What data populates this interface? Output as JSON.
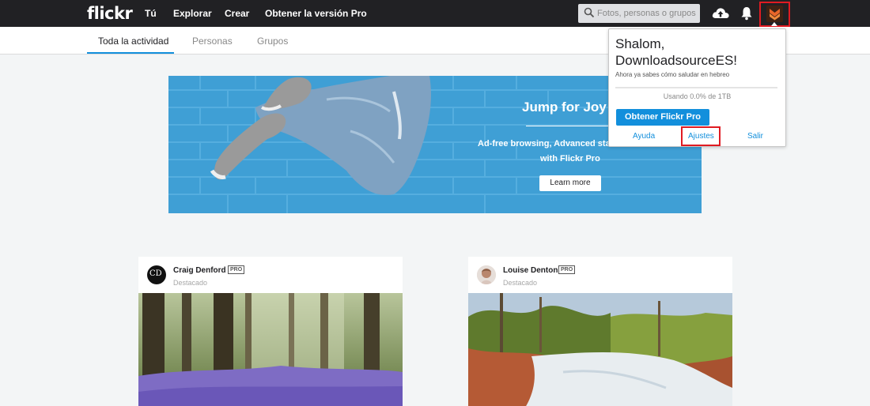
{
  "brand": {
    "logo_text": "flickr"
  },
  "nav": {
    "links": [
      "Tú",
      "Explorar",
      "Crear",
      "Obtener la versión Pro"
    ]
  },
  "search": {
    "placeholder": "Fotos, personas o grupos"
  },
  "icons": {
    "search": "magnifier-icon",
    "upload": "cloud-upload-icon",
    "notifications": "bell-icon",
    "avatar": "user-avatar-icon"
  },
  "subnav": {
    "tabs": [
      "Toda la actividad",
      "Personas",
      "Grupos"
    ],
    "active_tab": "Toda la actividad"
  },
  "banner": {
    "title": "Jump for Joy",
    "line1": "Ad-free browsing, Advanced sta",
    "line2": "with Flickr Pro",
    "button": "Learn more"
  },
  "feed": [
    {
      "user": "Craig Denford",
      "avatar_text": "CD",
      "badge": "PRO",
      "label": "Destacado"
    },
    {
      "user": "Louise Denton",
      "avatar_text": "",
      "badge": "PRO",
      "label": "Destacado"
    }
  ],
  "account_menu": {
    "greeting_line1": "Shalom,",
    "greeting_line2": "DownloadsourceES!",
    "hint": "Ahora ya sabes cómo saludar en hebreo",
    "usage_text": "Usando 0.0% de 1TB",
    "usage_fraction": 0.0,
    "pro_button": "Obtener Flickr Pro",
    "links": [
      "Ayuda",
      "Ajustes",
      "Salir"
    ]
  },
  "colors": {
    "topbar": "#212124",
    "accent_blue": "#128fdc",
    "highlight_red": "#e01b22",
    "banner_blue": "#3f9fd5"
  }
}
